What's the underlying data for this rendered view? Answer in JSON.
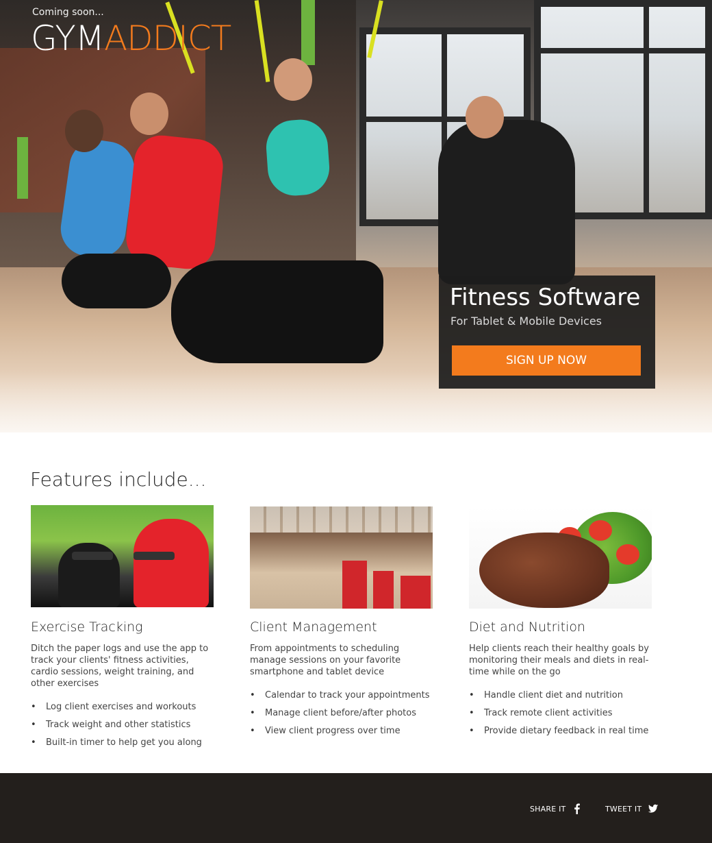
{
  "hero": {
    "tagline": "Coming soon...",
    "brand_part1": "GYM",
    "brand_part2": "ADDICT",
    "cta": {
      "title": "Fitness Software",
      "subtitle": "For Tablet & Mobile Devices",
      "button_label": "SIGN UP NOW"
    }
  },
  "features": {
    "heading": "Features include...",
    "items": [
      {
        "title": "Exercise Tracking",
        "description": "Ditch the paper logs and use the app to track your clients' fitness activities, cardio sessions, weight training, and other exercises",
        "bullets": [
          "Log client exercises and workouts",
          "Track weight and other statistics",
          "Built-in timer to help get you along"
        ]
      },
      {
        "title": "Client Management",
        "description": "From appointments to scheduling manage sessions on your favorite smartphone and tablet device",
        "bullets": [
          "Calendar to track your appointments",
          "Manage client before/after photos",
          "View client progress over time"
        ]
      },
      {
        "title": "Diet and Nutrition",
        "description": "Help clients reach their healthy goals by monitoring their meals and diets in real-time while on the go",
        "bullets": [
          "Handle client diet and nutrition",
          "Track remote client activities",
          "Provide dietary feedback in real time"
        ]
      }
    ]
  },
  "footer": {
    "share_label": "SHARE IT",
    "tweet_label": "TWEET IT"
  },
  "colors": {
    "accent": "#f37b1d",
    "footer_bg": "#231f1c",
    "cta_bg": "#1c1c1c"
  },
  "icons": {
    "share": "facebook-icon",
    "tweet": "twitter-icon"
  }
}
